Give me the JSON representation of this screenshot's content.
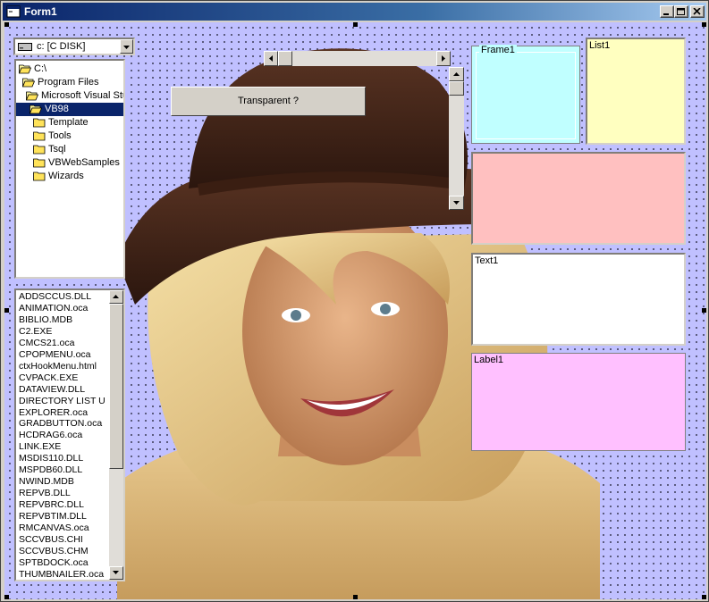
{
  "window": {
    "title": "Form1",
    "controls": {
      "minimize": "minimize",
      "maximize": "maximize",
      "close": "close"
    }
  },
  "drive": {
    "value": "c: [C DISK]"
  },
  "dirlist": {
    "items": [
      {
        "label": "C:\\",
        "icon": "open-folder",
        "indent": 0
      },
      {
        "label": "Program Files",
        "icon": "open-folder",
        "indent": 1
      },
      {
        "label": "Microsoft Visual Stu",
        "icon": "open-folder",
        "indent": 2
      },
      {
        "label": "VB98",
        "icon": "open-folder",
        "indent": 3,
        "selected": true
      },
      {
        "label": "Template",
        "icon": "closed-folder",
        "indent": 4
      },
      {
        "label": "Tools",
        "icon": "closed-folder",
        "indent": 4
      },
      {
        "label": "Tsql",
        "icon": "closed-folder",
        "indent": 4
      },
      {
        "label": "VBWebSamples",
        "icon": "closed-folder",
        "indent": 4
      },
      {
        "label": "Wizards",
        "icon": "closed-folder",
        "indent": 4
      }
    ]
  },
  "filelist": {
    "items": [
      "ADDSCCUS.DLL",
      "ANIMATION.oca",
      "BIBLIO.MDB",
      "C2.EXE",
      "CMCS21.oca",
      "CPOPMENU.oca",
      "ctxHookMenu.html",
      "CVPACK.EXE",
      "DATAVIEW.DLL",
      "DIRECTORY LIST U",
      "EXPLORER.oca",
      "GRADBUTTON.oca",
      "HCDRAG6.oca",
      "LINK.EXE",
      "MSDIS110.DLL",
      "MSPDB60.DLL",
      "NWIND.MDB",
      "REPVB.DLL",
      "REPVBRC.DLL",
      "REPVBTIM.DLL",
      "RMCANVAS.oca",
      "SCCVBUS.CHI",
      "SCCVBUS.CHM",
      "SPTBDOCK.oca",
      "THUMBNAILER.oca"
    ]
  },
  "button": {
    "label": "Transparent ?"
  },
  "frame1": {
    "label": "Frame1"
  },
  "list1": {
    "label": "List1"
  },
  "text1": {
    "value": "Text1"
  },
  "label1": {
    "label": "Label1"
  },
  "colors": {
    "form_back": "#c0c0ff",
    "frame_back": "#c0ffff",
    "list_back": "#ffffc0",
    "picture_back": "#ffc0c0",
    "label_back": "#ffc0ff",
    "selection": "#0a246a"
  }
}
